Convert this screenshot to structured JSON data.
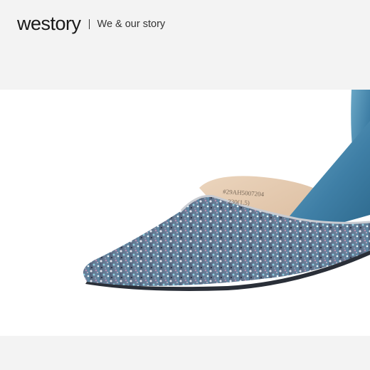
{
  "header": {
    "logo": "westory",
    "tagline": "We & our story"
  },
  "photo": {
    "label_code": "#29AH5007204",
    "label_size": "230(1.5)",
    "colors": {
      "glitter_base": "#5a6b82",
      "suede": "#4f8fb2",
      "lining": "#e9cfb4",
      "background": "#ffffff"
    }
  }
}
